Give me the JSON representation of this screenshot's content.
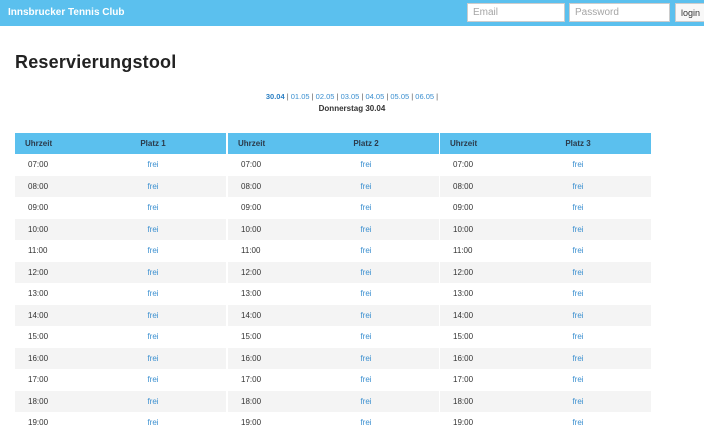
{
  "header": {
    "brand": "Innsbrucker Tennis Club",
    "email_placeholder": "Email",
    "password_placeholder": "Password",
    "login_label": "login"
  },
  "page_title": "Reservierungstool",
  "date_nav": {
    "dates": [
      "30.04",
      "01.05",
      "02.05",
      "03.05",
      "04.05",
      "05.05",
      "06.05"
    ],
    "active_index": 0,
    "selected_day": "Donnerstag 30.04"
  },
  "courts": [
    {
      "time_header": "Uhrzeit",
      "court_header": "Platz 1"
    },
    {
      "time_header": "Uhrzeit",
      "court_header": "Platz 2"
    },
    {
      "time_header": "Uhrzeit",
      "court_header": "Platz 3"
    }
  ],
  "slots": [
    {
      "time": "07:00",
      "status": "frei"
    },
    {
      "time": "08:00",
      "status": "frei"
    },
    {
      "time": "09:00",
      "status": "frei"
    },
    {
      "time": "10:00",
      "status": "frei"
    },
    {
      "time": "11:00",
      "status": "frei"
    },
    {
      "time": "12:00",
      "status": "frei"
    },
    {
      "time": "13:00",
      "status": "frei"
    },
    {
      "time": "14:00",
      "status": "frei"
    },
    {
      "time": "15:00",
      "status": "frei"
    },
    {
      "time": "16:00",
      "status": "frei"
    },
    {
      "time": "17:00",
      "status": "frei"
    },
    {
      "time": "18:00",
      "status": "frei"
    },
    {
      "time": "19:00",
      "status": "frei"
    }
  ],
  "colors": {
    "accent": "#5bc0ee",
    "link": "#3a8fd0"
  }
}
